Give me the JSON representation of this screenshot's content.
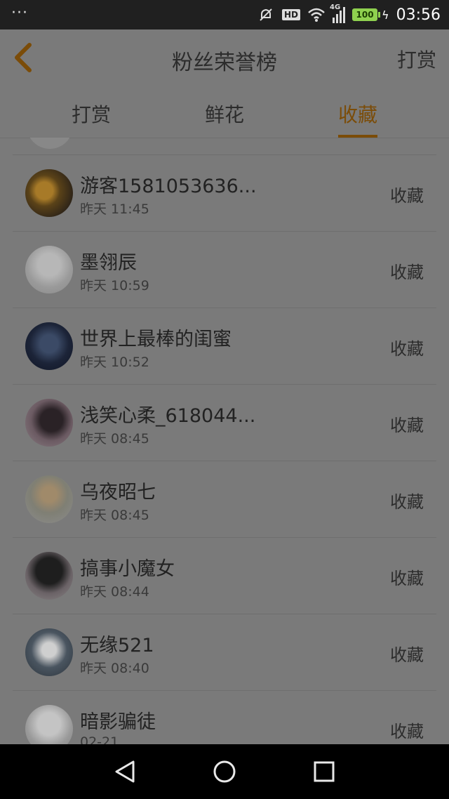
{
  "status_bar": {
    "menu_dots": "···",
    "hd_label": "HD",
    "network_label": "4G",
    "battery_level": "100",
    "time": "03:56"
  },
  "header": {
    "title": "粉丝荣誉榜",
    "right_action": "打赏",
    "back_icon": "chevron-left-icon"
  },
  "tabs": [
    {
      "label": "打赏",
      "active": false
    },
    {
      "label": "鲜花",
      "active": false
    },
    {
      "label": "收藏",
      "active": true
    }
  ],
  "accent_color": "#7b4c08",
  "list": {
    "items": [
      {
        "name": "游客1581053636...",
        "time": "昨天 11:45",
        "action": "收藏"
      },
      {
        "name": "墨翎辰",
        "time": "昨天 10:59",
        "action": "收藏"
      },
      {
        "name": "世界上最棒的闺蜜",
        "time": "昨天 10:52",
        "action": "收藏"
      },
      {
        "name": "浅笑心柔_618044...",
        "time": "昨天 08:45",
        "action": "收藏"
      },
      {
        "name": "乌夜昭七",
        "time": "昨天 08:45",
        "action": "收藏"
      },
      {
        "name": "搞事小魔女",
        "time": "昨天 08:44",
        "action": "收藏"
      },
      {
        "name": "无缘521",
        "time": "昨天 08:40",
        "action": "收藏"
      },
      {
        "name": "暗影骗徒",
        "time": "02-21",
        "action": "收藏"
      }
    ]
  },
  "nav_bar": {
    "back_icon": "triangle-back-icon",
    "home_icon": "circle-home-icon",
    "recents_icon": "square-recents-icon"
  }
}
